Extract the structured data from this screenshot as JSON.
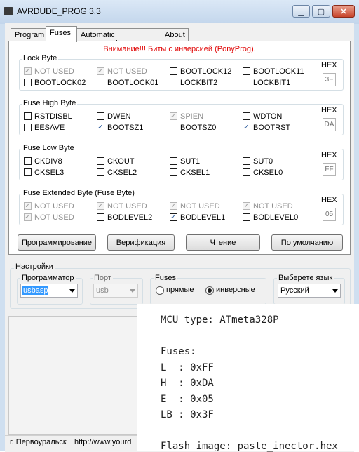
{
  "window": {
    "title": "AVRDUDE_PROG 3.3",
    "minimize": "▁",
    "maximize": "▢",
    "close": "✕"
  },
  "tabs": [
    "Program",
    "Fuses",
    "Automatic programming",
    "About"
  ],
  "warning": "Внимание!!! Биты с инверсией (PonyProg).",
  "hex_label": "HEX",
  "lock_byte": {
    "title": "Lock Byte",
    "hex": "3F",
    "bits": [
      {
        "label": "NOT USED",
        "checked": true,
        "disabled": true
      },
      {
        "label": "NOT USED",
        "checked": true,
        "disabled": true
      },
      {
        "label": "BOOTLOCK12",
        "checked": false,
        "disabled": false
      },
      {
        "label": "BOOTLOCK11",
        "checked": false,
        "disabled": false
      },
      {
        "label": "BOOTLOCK02",
        "checked": false,
        "disabled": false
      },
      {
        "label": "BOOTLOCK01",
        "checked": false,
        "disabled": false
      },
      {
        "label": "LOCKBIT2",
        "checked": false,
        "disabled": false
      },
      {
        "label": "LOCKBIT1",
        "checked": false,
        "disabled": false
      }
    ]
  },
  "fuse_high": {
    "title": "Fuse High Byte",
    "hex": "DA",
    "bits": [
      {
        "label": "RSTDISBL",
        "checked": false,
        "disabled": false
      },
      {
        "label": "DWEN",
        "checked": false,
        "disabled": false
      },
      {
        "label": "SPIEN",
        "checked": true,
        "disabled": true
      },
      {
        "label": "WDTON",
        "checked": false,
        "disabled": false
      },
      {
        "label": "EESAVE",
        "checked": false,
        "disabled": false
      },
      {
        "label": "BOOTSZ1",
        "checked": true,
        "disabled": false
      },
      {
        "label": "BOOTSZ0",
        "checked": false,
        "disabled": false
      },
      {
        "label": "BOOTRST",
        "checked": true,
        "disabled": false
      }
    ]
  },
  "fuse_low": {
    "title": "Fuse Low Byte",
    "hex": "FF",
    "bits": [
      {
        "label": "CKDIV8",
        "checked": false,
        "disabled": false
      },
      {
        "label": "CKOUT",
        "checked": false,
        "disabled": false
      },
      {
        "label": "SUT1",
        "checked": false,
        "disabled": false
      },
      {
        "label": "SUT0",
        "checked": false,
        "disabled": false
      },
      {
        "label": "CKSEL3",
        "checked": false,
        "disabled": false
      },
      {
        "label": "CKSEL2",
        "checked": false,
        "disabled": false
      },
      {
        "label": "CKSEL1",
        "checked": false,
        "disabled": false
      },
      {
        "label": "CKSEL0",
        "checked": false,
        "disabled": false
      }
    ]
  },
  "fuse_ext": {
    "title": "Fuse Extended Byte (Fuse Byte)",
    "hex": "05",
    "bits": [
      {
        "label": "NOT USED",
        "checked": true,
        "disabled": true
      },
      {
        "label": "NOT USED",
        "checked": true,
        "disabled": true
      },
      {
        "label": "NOT USED",
        "checked": true,
        "disabled": true
      },
      {
        "label": "NOT USED",
        "checked": true,
        "disabled": true
      },
      {
        "label": "NOT USED",
        "checked": true,
        "disabled": true
      },
      {
        "label": "BODLEVEL2",
        "checked": false,
        "disabled": false
      },
      {
        "label": "BODLEVEL1",
        "checked": true,
        "disabled": false
      },
      {
        "label": "BODLEVEL0",
        "checked": false,
        "disabled": false
      }
    ]
  },
  "buttons": {
    "program": "Программирование",
    "verify": "Верификация",
    "read": "Чтение",
    "default": "По умолчанию"
  },
  "settings": {
    "title": "Настройки",
    "programmer_label": "Программатор",
    "programmer_value": "usbasp",
    "port_label": "Порт",
    "port_value": "usb",
    "fuses_label": "Fuses",
    "radio_direct": "прямые",
    "radio_inverse": "инверсные",
    "lang_label": "Выберете язык",
    "lang_value": "Русский"
  },
  "status": {
    "city": "г. Первоуральск",
    "url": "http://www.yourd"
  },
  "overlay_lines": [
    "MCU type: ATmeta328P",
    "",
    "Fuses:",
    "L  : 0xFF",
    "H  : 0xDA",
    "E  : 0x05",
    "LB : 0x3F",
    "",
    "Flash image: paste_inector.hex"
  ]
}
